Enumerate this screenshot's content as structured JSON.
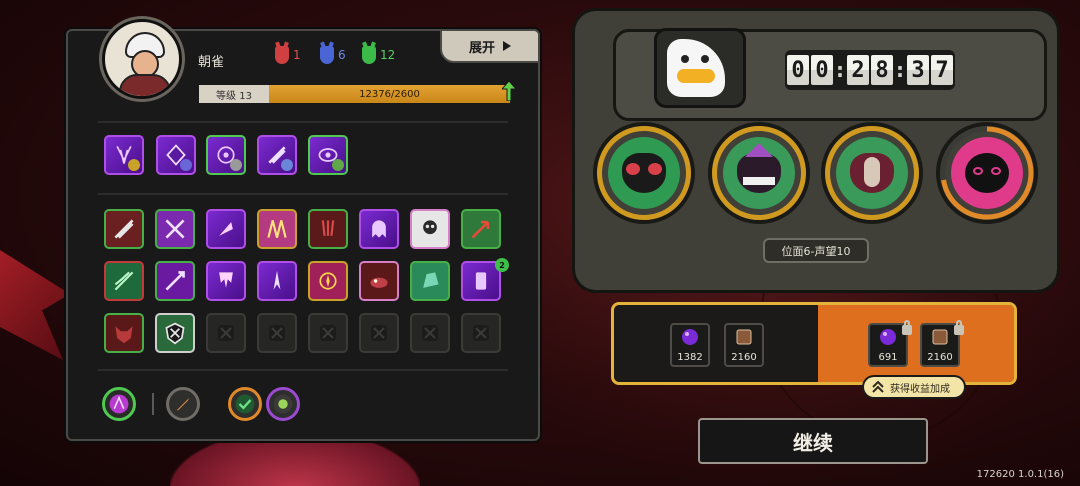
{
  "player": {
    "name": "朝雀",
    "level_label": "等级 13",
    "xp_text": "12376/2600",
    "xp_fraction": 1.0
  },
  "masks": [
    {
      "count": "1",
      "color": "#d04040"
    },
    {
      "count": "6",
      "color": "#4a66d6"
    },
    {
      "count": "12",
      "color": "#3dbb4a"
    }
  ],
  "expand_label": "展开",
  "timer": {
    "h1": "0",
    "h2": "0",
    "m1": "2",
    "m2": "8",
    "s1": "3",
    "s2": "7"
  },
  "plane_label": "位面6-声望10",
  "rewards": {
    "base": [
      {
        "icon": "purple-orb-icon",
        "value": "1382"
      },
      {
        "icon": "book-icon",
        "value": "2160"
      }
    ],
    "bonus": [
      {
        "icon": "purple-orb-icon",
        "value": "691"
      },
      {
        "icon": "book-icon",
        "value": "2160"
      }
    ],
    "bonus_label": "获得收益加成"
  },
  "continue_label": "继续",
  "version": "172620 1.0.1(16)",
  "skill_badge": "2",
  "colors": {
    "accent_gold": "#d09a21",
    "reward_orange": "#dd6f1e",
    "xp_bar": "#d9951f"
  }
}
